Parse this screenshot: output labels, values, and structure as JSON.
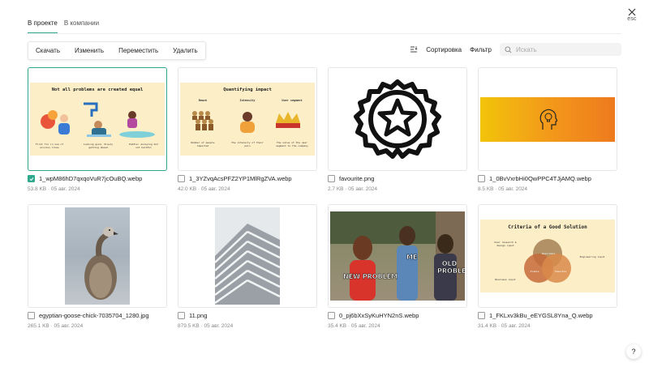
{
  "tabs": [
    {
      "label": "В проекте",
      "active": true
    },
    {
      "label": "В компании",
      "active": false
    }
  ],
  "close": {
    "label": "esc"
  },
  "actions": {
    "download": "Скачать",
    "edit": "Изменить",
    "move": "Переместить",
    "delete": "Удалить"
  },
  "toolbar": {
    "sort": "Сортировка",
    "filter": "Фильтр",
    "search_placeholder": "Искать"
  },
  "accent": "#2fa98e",
  "files": [
    {
      "name": "1_wpM86hD7qxqoVuR7jcOuBQ.webp",
      "meta": "53.8 KB · 05 авг. 2024",
      "selected": true,
      "poster": {
        "title": "Not all problems are created equal",
        "captions": [
          "First fix in one of ecculus lines",
          "Looking good, Slowly getting ahead",
          "Puddle: Annoying but not harmful"
        ]
      }
    },
    {
      "name": "1_3YZvqAcsPFZ2YP1MlRgZVA.webp",
      "meta": "42.0 KB · 05 авг. 2024",
      "selected": false,
      "poster": {
        "title": "Quantifying impact",
        "headers": [
          "Reach",
          "Intensity",
          "User segment"
        ],
        "captions": [
          "Number of people impacted",
          "The intensity of their pain",
          "The value of the user segment to the company"
        ]
      }
    },
    {
      "name": "favourite.png",
      "meta": "2.7 KB · 05 авг. 2024",
      "selected": false
    },
    {
      "name": "1_0BvVxrbHi0QwPPC4TJjAMQ.webp",
      "meta": "8.5 KB · 05 авг. 2024",
      "selected": false
    },
    {
      "name": "egyptian-goose-chick-7035704_1280.jpg",
      "meta": "265.1 KB · 05 авг. 2024",
      "selected": false
    },
    {
      "name": "11.png",
      "meta": "879.5 KB · 05 авг. 2024",
      "selected": false
    },
    {
      "name": "0_pj6bXxSyKuHYN2nS.webp",
      "meta": "35.4 KB · 05 авг. 2024",
      "selected": false,
      "meme": {
        "left": "NEW PROBLEM",
        "center": "ME",
        "right": "OLD PROBLEM"
      }
    },
    {
      "name": "1_FKLxv3kBu_eEYGSL8Yna_Q.webp",
      "meta": "31.4 KB · 05 авг. 2024",
      "selected": false,
      "poster": {
        "title": "Criteria of a Good Solution",
        "labels": [
          "User research & design input",
          "Business input",
          "Engineering input"
        ],
        "inner": [
          "Desirable",
          "Viable",
          "Feasible"
        ]
      }
    }
  ],
  "help": {
    "label": "?"
  }
}
